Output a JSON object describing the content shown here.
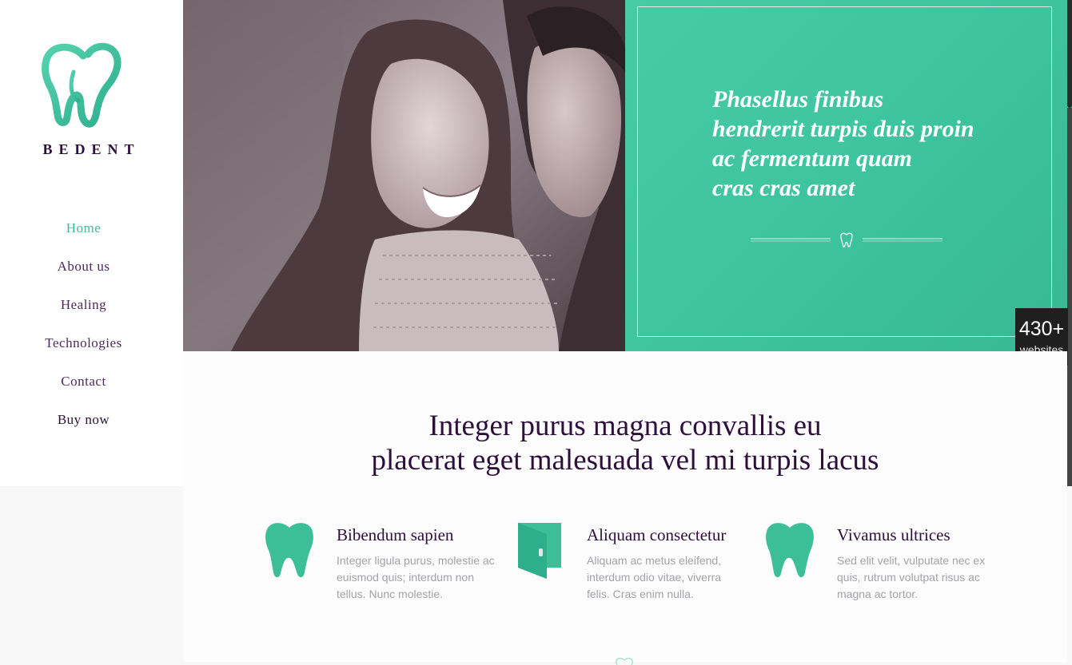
{
  "brand": {
    "name": "BEDENT"
  },
  "nav": {
    "items": [
      {
        "label": "Home",
        "active": true
      },
      {
        "label": "About us"
      },
      {
        "label": "Healing"
      },
      {
        "label": "Technologies"
      },
      {
        "label": "Contact"
      },
      {
        "label": "Buy now"
      }
    ]
  },
  "hero": {
    "quote_lines": [
      "Phasellus finibus",
      "hendrerit turpis duis proin",
      "ac fermentum quam",
      "cras cras amet"
    ]
  },
  "badge": {
    "count": "430+",
    "label": "websites"
  },
  "intro": {
    "headline_lines": [
      "Integer purus magna convallis eu",
      "placerat eget malesuada vel mi turpis lacus"
    ]
  },
  "features": [
    {
      "icon": "tooth-icon",
      "title": "Bibendum sapien",
      "text": "Integer ligula purus, molestie ac euismod quis; interdum non tellus. Nunc molestie."
    },
    {
      "icon": "wallet-icon",
      "title": "Aliquam consectetur",
      "text": "Aliquam ac metus eleifend, interdum odio vitae, viverra felis. Cras enim nulla."
    },
    {
      "icon": "tooth-icon",
      "title": "Vivamus ultrices",
      "text": "Sed elit velit, vulputate nec ex quis, rutrum volutpat risus ac magna ac tortor."
    }
  ],
  "colors": {
    "accent": "#3cbf97",
    "heading": "#2c0f3b",
    "panel": "#43c6a2"
  }
}
